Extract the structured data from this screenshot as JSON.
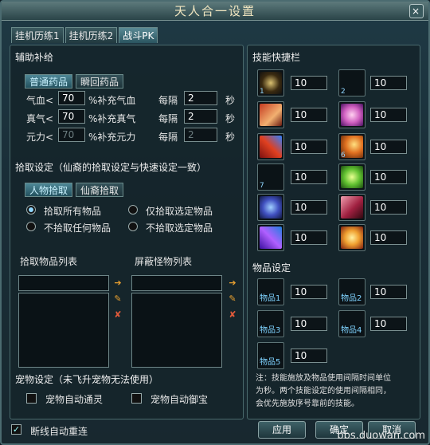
{
  "window": {
    "title": "天人合一设置",
    "close_glyph": "×"
  },
  "tabs": [
    {
      "label": "挂机历练1"
    },
    {
      "label": "挂机历练2"
    },
    {
      "label": "战斗PK"
    }
  ],
  "assist": {
    "title": "辅助补给",
    "subtabs": [
      "普通药品",
      "瞬回药品"
    ],
    "rows": [
      {
        "label": "气血<",
        "value": "70",
        "suffix": "%补充气血",
        "interval_label": "每隔",
        "interval": "2",
        "unit": "秒"
      },
      {
        "label": "真气<",
        "value": "70",
        "suffix": "%补充真气",
        "interval_label": "每隔",
        "interval": "2",
        "unit": "秒"
      },
      {
        "label": "元力<",
        "value": "70",
        "suffix": "%补充元力",
        "interval_label": "每隔",
        "interval": "2",
        "unit": "秒"
      }
    ]
  },
  "pickup": {
    "title": "拾取设定（仙裔的拾取设定与快速设定一致）",
    "subtabs": [
      "人物拾取",
      "仙裔拾取"
    ],
    "options": [
      "拾取所有物品",
      "仅拾取选定物品",
      "不拾取任何物品",
      "不拾取选定物品"
    ],
    "list_title": "拾取物品列表",
    "block_title": "屏蔽怪物列表"
  },
  "pet": {
    "title": "宠物设定（未飞升宠物无法使用）",
    "options": [
      "宠物自动通灵",
      "宠物自动御宝"
    ]
  },
  "reconnect": {
    "label": "断线自动重连",
    "check": "✓"
  },
  "skills": {
    "title": "技能快捷栏",
    "slots": [
      {
        "num": "1",
        "value": "10"
      },
      {
        "num": "2",
        "value": "10"
      },
      {
        "num": "",
        "value": "10"
      },
      {
        "num": "",
        "value": "10"
      },
      {
        "num": "",
        "value": "10"
      },
      {
        "num": "6",
        "value": "10"
      },
      {
        "num": "7",
        "value": "10"
      },
      {
        "num": "",
        "value": "10"
      },
      {
        "num": "",
        "value": "10"
      },
      {
        "num": "",
        "value": "10"
      },
      {
        "num": "",
        "value": "10"
      },
      {
        "num": "",
        "value": "10"
      }
    ]
  },
  "items": {
    "title": "物品设定",
    "slots": [
      {
        "label": "物品1",
        "value": "10"
      },
      {
        "label": "物品2",
        "value": "10"
      },
      {
        "label": "物品3",
        "value": "10"
      },
      {
        "label": "物品4",
        "value": "10"
      },
      {
        "label": "物品5",
        "value": "10"
      }
    ],
    "note_lines": [
      "注：技能施放及物品使用间隔时间单位",
      "为秒。两个技能设定的使用间隔相同，",
      "会优先施放序号靠前的技能。"
    ]
  },
  "buttons": {
    "apply": "应用",
    "ok": "确定",
    "cancel": "取消"
  },
  "watermark": "bbs.duowan.com"
}
